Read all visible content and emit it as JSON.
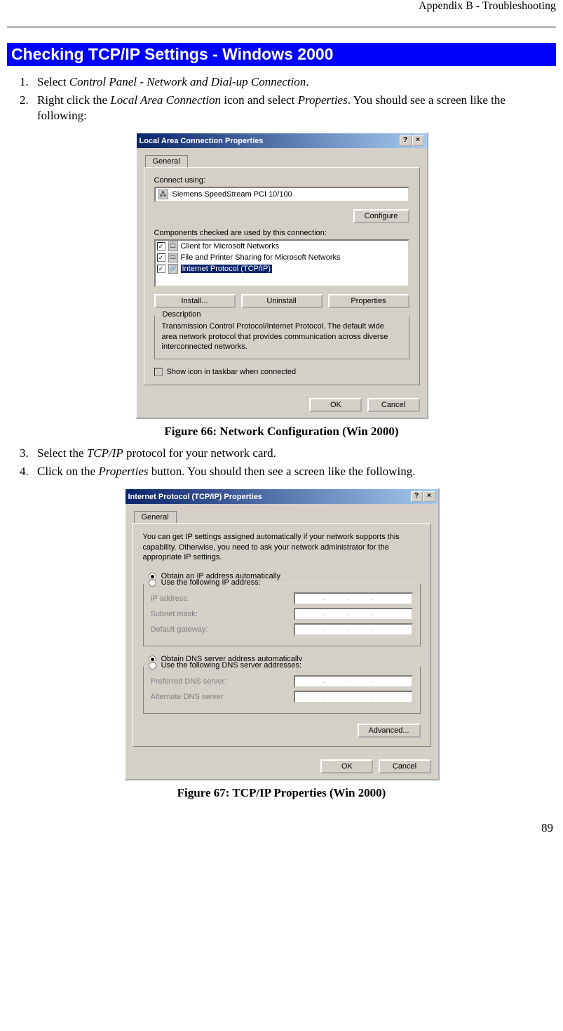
{
  "header": {
    "appendix": "Appendix B - Troubleshooting"
  },
  "heading": "Checking TCP/IP Settings - Windows 2000",
  "steps1": {
    "s1_a": "Select ",
    "s1_i": "Control Panel - Network and Dial-up Connection",
    "s1_b": ".",
    "s2_a": "Right click the ",
    "s2_i": "Local Area Connection",
    "s2_b": " icon and select ",
    "s2_i2": "Properties",
    "s2_c": ". You should see a screen like the following:"
  },
  "dlg1": {
    "title": "Local Area Connection Properties",
    "help_btn": "?",
    "close_btn": "×",
    "tab": "General",
    "connect_using_lbl": "Connect using:",
    "adapter": "Siemens SpeedStream PCI 10/100",
    "configure_btn": "Configure",
    "components_lbl": "Components checked are used by this connection:",
    "item1": "Client for Microsoft Networks",
    "item2": "File and Printer Sharing for Microsoft Networks",
    "item3": "Internet Protocol (TCP/IP)",
    "install_btn": "Install...",
    "uninstall_btn": "Uninstall",
    "properties_btn": "Properties",
    "desc_legend": "Description",
    "desc_text": "Transmission Control Protocol/Internet Protocol. The default wide area network protocol that provides communication across diverse interconnected networks.",
    "show_icon": "Show icon in taskbar when connected",
    "ok_btn": "OK",
    "cancel_btn": "Cancel"
  },
  "fig1_caption": "Figure 66: Network Configuration (Win 2000)",
  "steps2": {
    "s3_a": "Select the ",
    "s3_i": "TCP/IP",
    "s3_b": " protocol for your network card.",
    "s4_a": "Click on the ",
    "s4_i": "Properties",
    "s4_b": " button. You should then see a screen like the following."
  },
  "dlg2": {
    "title": "Internet Protocol (TCP/IP) Properties",
    "help_btn": "?",
    "close_btn": "×",
    "tab": "General",
    "intro": "You can get IP settings assigned automatically if your network supports this capability. Otherwise, you need to ask your network administrator for the appropriate IP settings.",
    "r_auto_ip": "Obtain an IP address automatically",
    "r_use_ip": "Use the following IP address:",
    "ip_lbl": "IP address:",
    "mask_lbl": "Subnet mask:",
    "gw_lbl": "Default gateway:",
    "r_auto_dns": "Obtain DNS server address automatically",
    "r_use_dns": "Use the following DNS server addresses:",
    "pref_dns_lbl": "Preferred DNS server:",
    "alt_dns_lbl": "Alternate DNS server:",
    "dots": ".   .   .",
    "advanced_btn": "Advanced...",
    "ok_btn": "OK",
    "cancel_btn": "Cancel"
  },
  "fig2_caption": "Figure 67: TCP/IP Properties (Win 2000)",
  "page_number": "89"
}
